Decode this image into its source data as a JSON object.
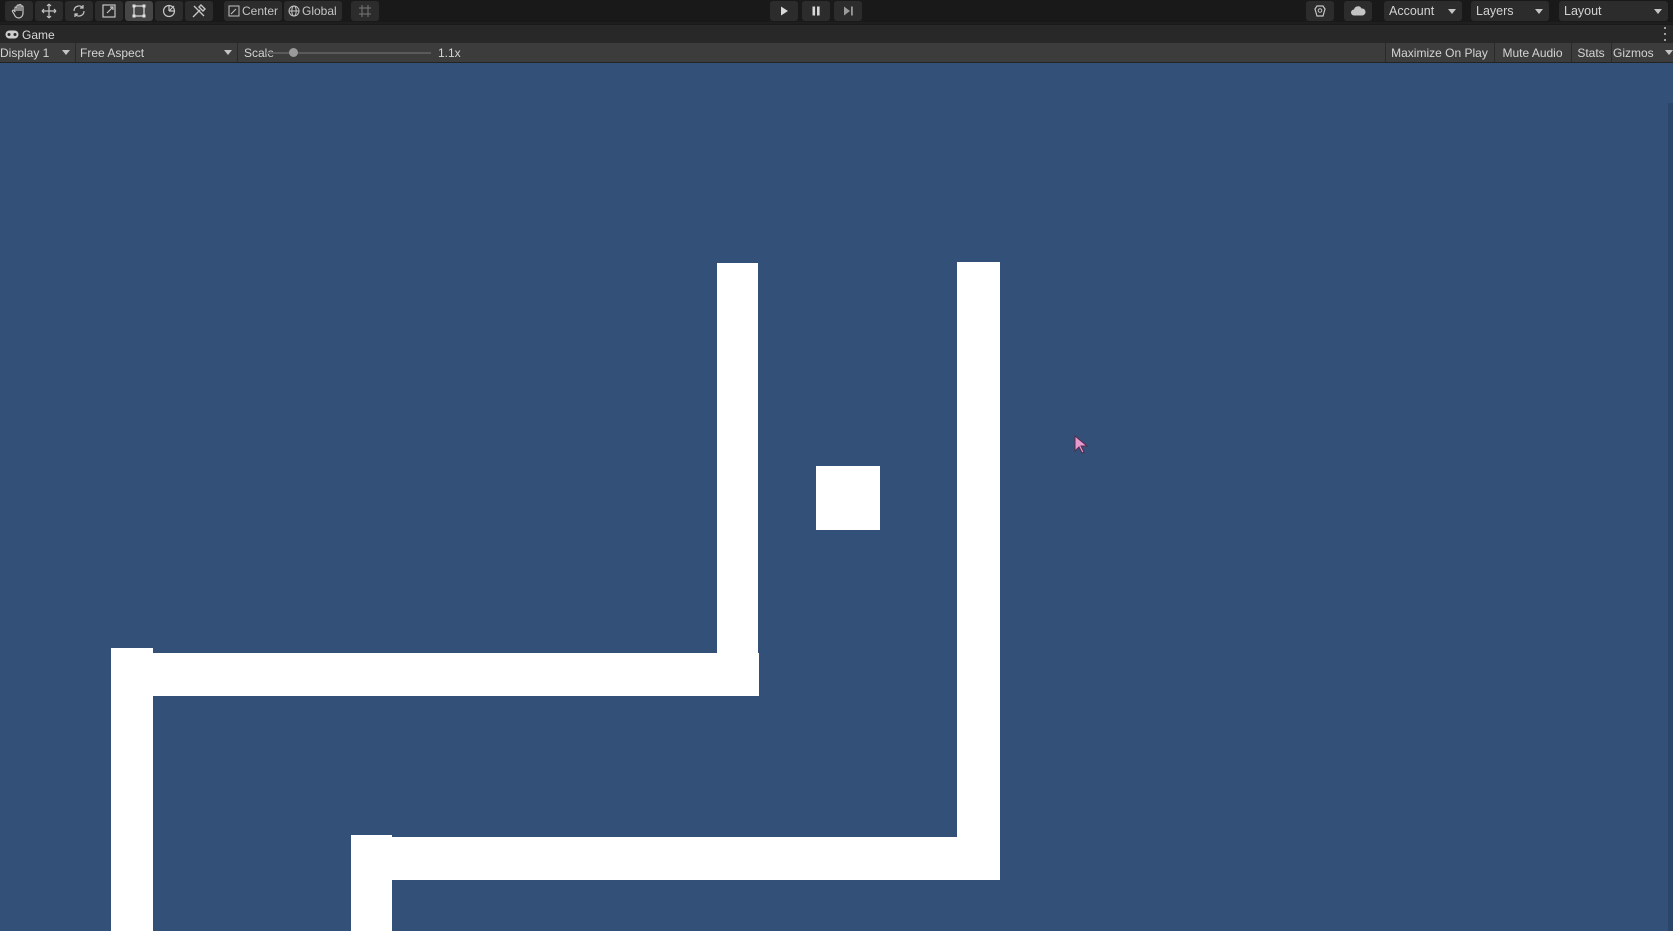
{
  "toolbar": {
    "tools": [
      "hand-icon",
      "move-icon",
      "rotate-icon",
      "scale-icon",
      "rect-icon",
      "transform-icon",
      "custom-tool-icon"
    ],
    "pivot_mode": "Center",
    "pivot_rotation": "Global",
    "account_label": "Account",
    "layers_label": "Layers",
    "layout_label": "Layout"
  },
  "tab": {
    "title": "Game"
  },
  "game_toolbar": {
    "display": "Display 1",
    "aspect": "Free Aspect",
    "scale_label": "Scale",
    "scale_value": "1.1x",
    "maximize_label": "Maximize On Play",
    "mute_label": "Mute Audio",
    "stats_label": "Stats",
    "gizmos_label": "Gizmos"
  },
  "game_view": {
    "background_color": "#325078",
    "wall_color": "#ffffff",
    "player_color": "#ffffff"
  }
}
